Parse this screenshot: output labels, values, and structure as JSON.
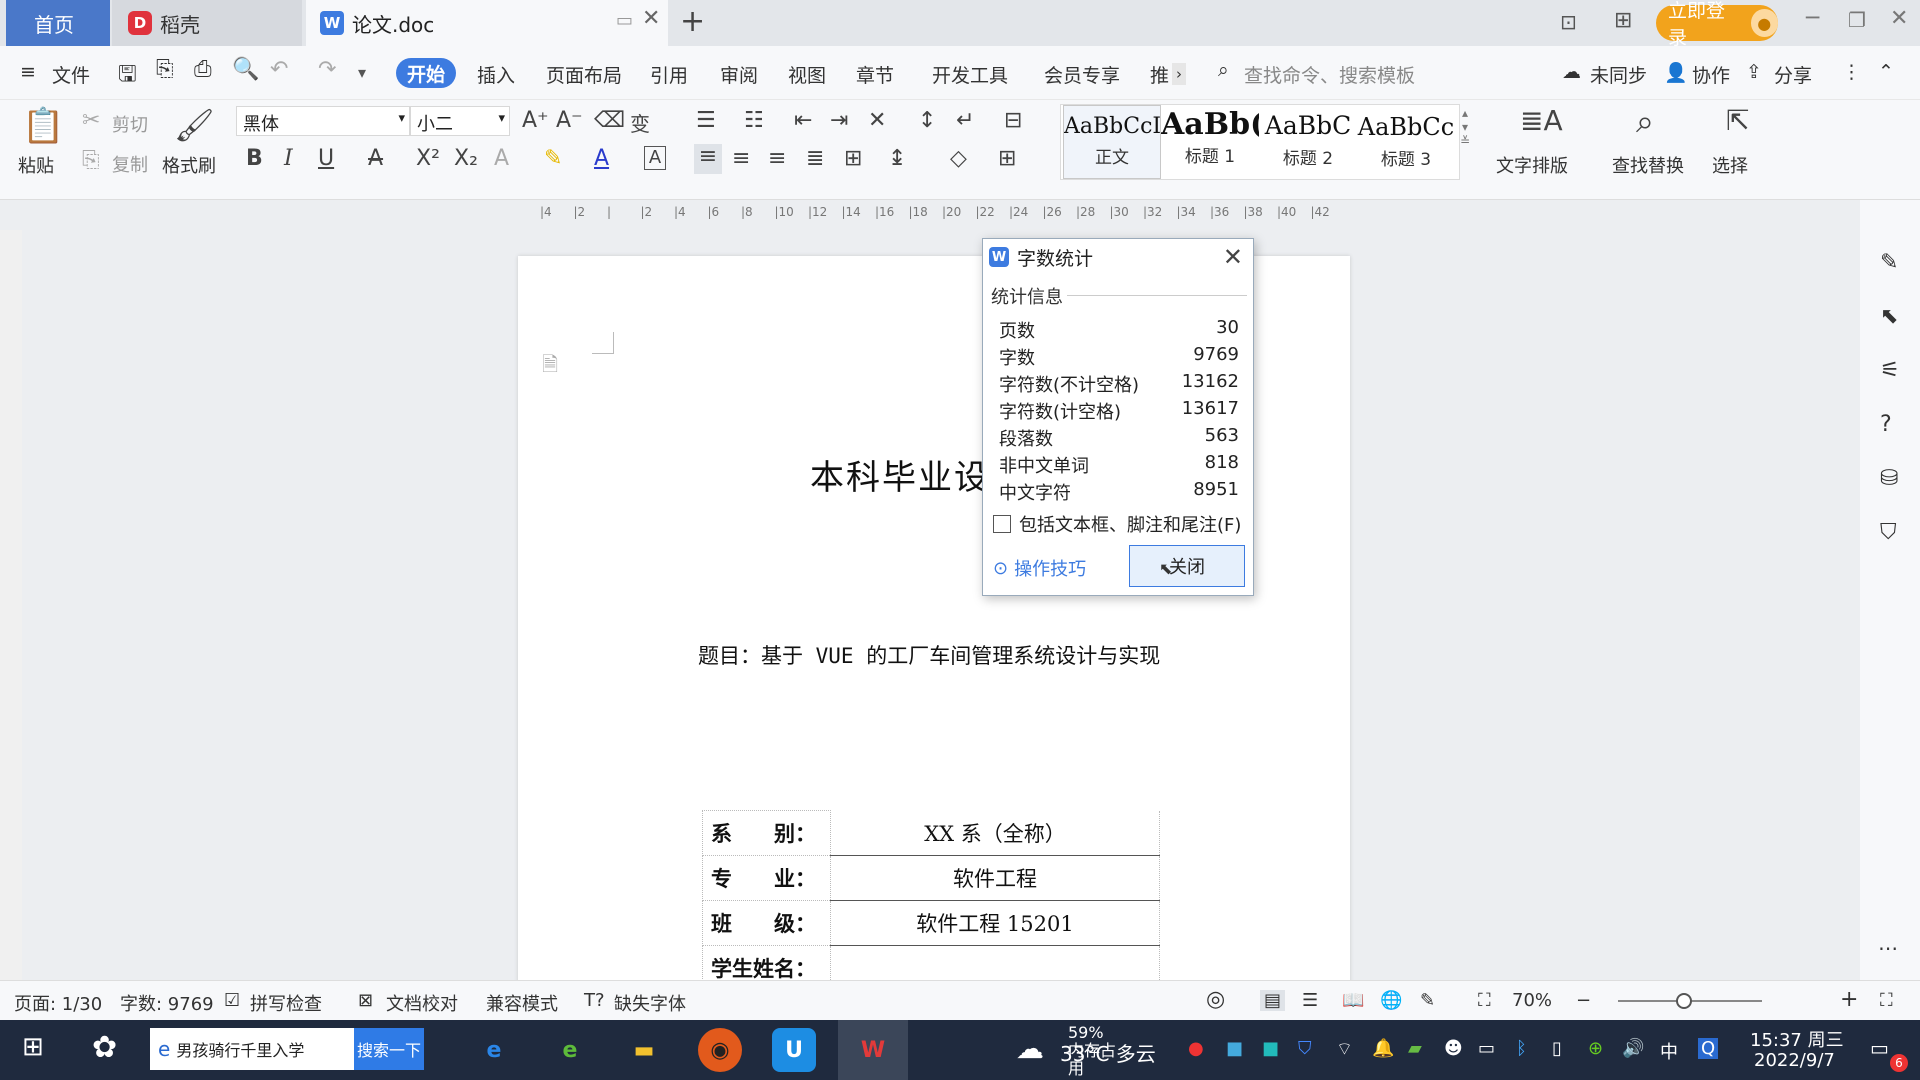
{
  "tabs": {
    "home": "首页",
    "daoke": "稻壳",
    "doc": "论文.doc",
    "login": "立即登录"
  },
  "menu": {
    "file": "文件",
    "start": "开始",
    "insert": "插入",
    "layout": "页面布局",
    "ref": "引用",
    "review": "审阅",
    "view": "视图",
    "chapter": "章节",
    "dev": "开发工具",
    "member": "会员专享",
    "more": "推",
    "search_placeholder": "查找命令、搜索模板",
    "unsync": "未同步",
    "collab": "协作",
    "share": "分享"
  },
  "ribbon": {
    "paste": "粘贴",
    "cut": "剪切",
    "copy": "复制",
    "format_painter": "格式刷",
    "font": "黑体",
    "size": "小二",
    "styles": [
      {
        "sample": "AaBbCcI",
        "name": "正文"
      },
      {
        "sample": "AaBb(",
        "name": "标题 1"
      },
      {
        "sample": "AaBbC",
        "name": "标题 2"
      },
      {
        "sample": "AaBbCc",
        "name": "标题 3"
      }
    ],
    "text_layout": "文字排版",
    "find_replace": "查找替换",
    "select": "选择"
  },
  "ruler": [
    "4",
    "2",
    "",
    "2",
    "4",
    "6",
    "8",
    "10",
    "12",
    "14",
    "16",
    "18",
    "20",
    "22",
    "24",
    "26",
    "28",
    "30",
    "32",
    "34",
    "36",
    "38",
    "40",
    "42"
  ],
  "document": {
    "title": "本科毕业设",
    "subject": "题目：基于 VUE 的工厂车间管理系统设计与实现",
    "table": [
      {
        "key": "系　　别：",
        "value": "XX 系（全称）"
      },
      {
        "key": "专　　业：",
        "value": "软件工程"
      },
      {
        "key": "班　　级：",
        "value": "软件工程 15201"
      },
      {
        "key": "学生姓名：",
        "value": ""
      }
    ]
  },
  "dialog": {
    "title": "字数统计",
    "section": "统计信息",
    "stats": [
      {
        "label": "页数",
        "value": "30"
      },
      {
        "label": "字数",
        "value": "9769"
      },
      {
        "label": "字符数(不计空格)",
        "value": "13162"
      },
      {
        "label": "字符数(计空格)",
        "value": "13617"
      },
      {
        "label": "段落数",
        "value": "563"
      },
      {
        "label": "非中文单词",
        "value": "818"
      },
      {
        "label": "中文字符",
        "value": "8951"
      }
    ],
    "include_checkbox": "包括文本框、脚注和尾注(F)",
    "tips": "操作技巧",
    "close": "关闭"
  },
  "status": {
    "page": "页面: 1/30",
    "words": "字数: 9769",
    "spell": "拼写检查",
    "proof": "文档校对",
    "compat": "兼容模式",
    "missing_font": "缺失字体",
    "zoom": "70%"
  },
  "taskbar": {
    "search_text": "男孩骑行千里入学",
    "search_btn": "搜索一下",
    "weather": "33°C 多云",
    "mem": "59% 内存占用",
    "ime": "中",
    "time": "15:37 周三",
    "date": "2022/9/7",
    "notif_count": "6"
  }
}
